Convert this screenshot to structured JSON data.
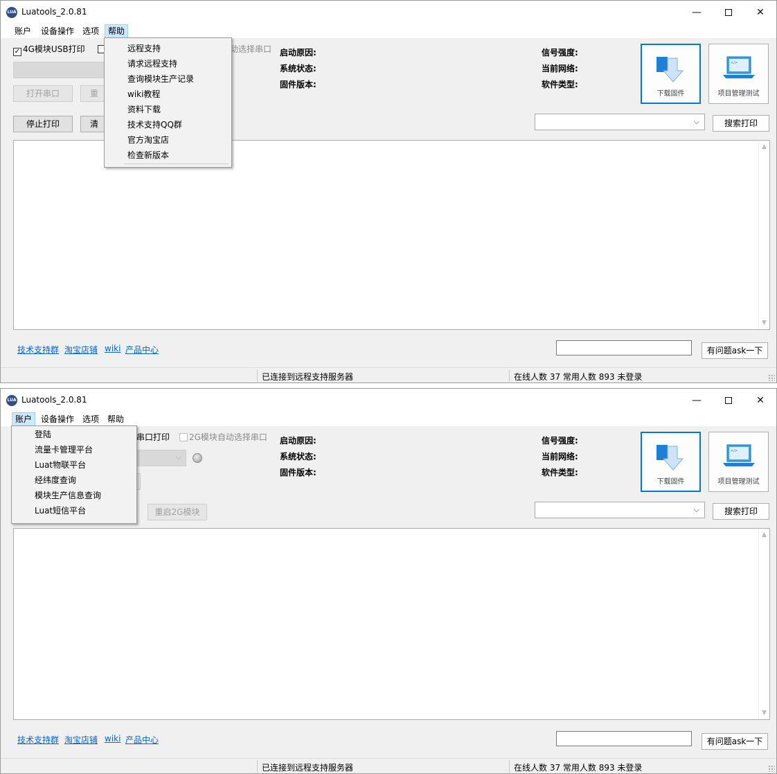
{
  "app": {
    "title": "Luatools_2.0.81",
    "icon_text": "LUA"
  },
  "window_controls": {
    "minimize": "—",
    "maximize": "□",
    "close": "✕"
  },
  "menu": [
    "账户",
    "设备操作",
    "选项",
    "帮助"
  ],
  "checks": {
    "usb_4g": "4G模块USB打印",
    "serial_print_partial": "串口打印",
    "auto_select_2g": "2G模块自动选择串口",
    "auto_select_partial": "动选择串口"
  },
  "buttons": {
    "open_serial": "打开串口",
    "restart_partial": "重",
    "restart_2g": "重启2G模块",
    "stop_print": "停止打印",
    "clear_partial": "清",
    "search_print": "搜索打印",
    "download_firmware": "下载固件",
    "project_test": "项目管理测试",
    "ask": "有问题ask一下"
  },
  "info_labels": {
    "boot_reason": "启动原因:",
    "system_status": "系统状态:",
    "firmware_version": "固件版本:",
    "signal_strength": "信号强度:",
    "current_network": "当前网络:",
    "software_type": "软件类型:"
  },
  "footer_links": [
    "技术支持群",
    "淘宝店铺",
    "wiki",
    "产品中心"
  ],
  "status": {
    "server": "已连接到远程支持服务器",
    "online": "在线人数 37 常用人数 893 未登录"
  },
  "help_menu": [
    "远程支持",
    "请求远程支持",
    "查询模块生产记录",
    "wiki教程",
    "资料下载",
    "技术支持QQ群",
    "官方淘宝店",
    "检查新版本"
  ],
  "account_menu": [
    "登陆",
    "流量卡管理平台",
    "Luat物联平台",
    "经纬度查询",
    "模块生产信息查询",
    "Luat短信平台"
  ],
  "colors": {
    "link": "#0066cc",
    "menu_highlight": "#cce8ff",
    "focus": "#0078d7",
    "arrow_blue": "#1e7fd6"
  },
  "icons": {
    "download": "download-arrow-icon",
    "laptop": "laptop-code-icon",
    "led": "status-led-icon"
  }
}
